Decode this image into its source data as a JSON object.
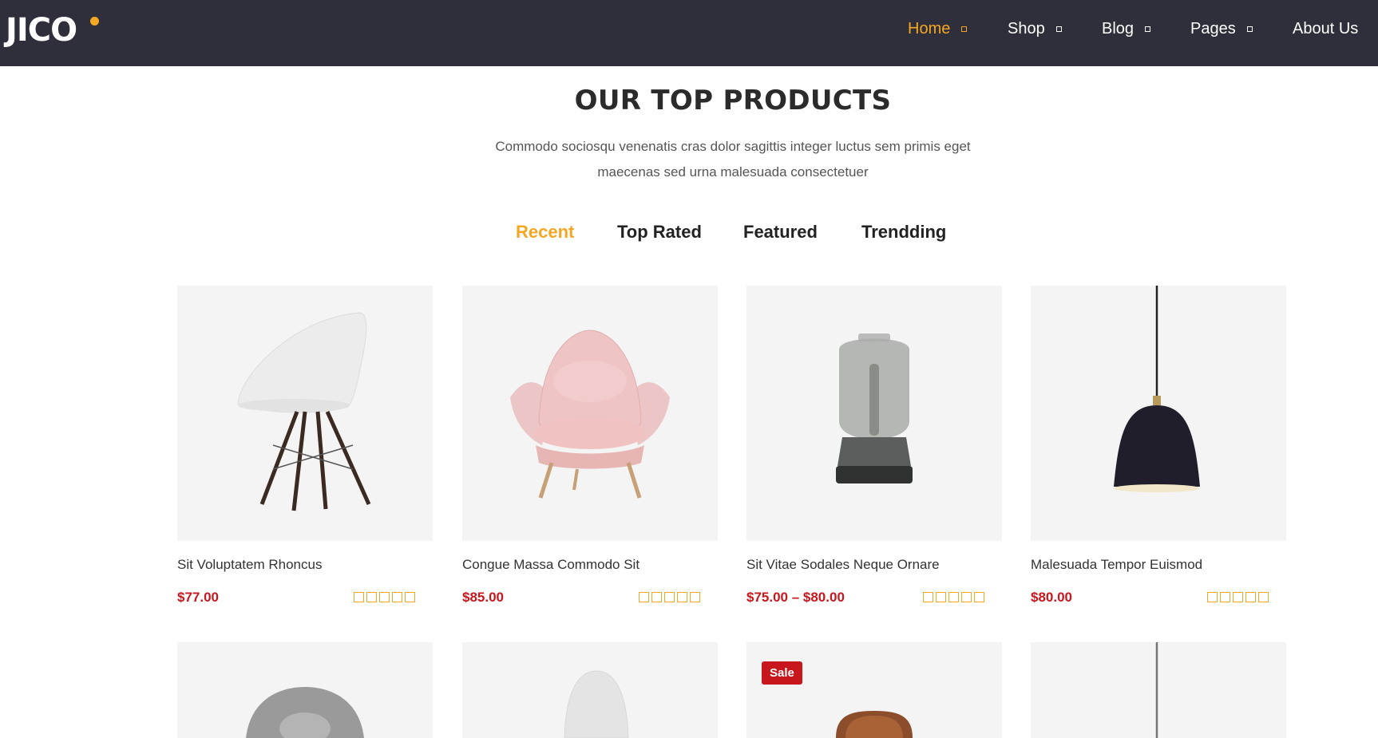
{
  "header": {
    "logo_text": "JICO",
    "nav": [
      {
        "label": "Home",
        "active": true
      },
      {
        "label": "Shop",
        "active": false
      },
      {
        "label": "Blog",
        "active": false
      },
      {
        "label": "Pages",
        "active": false
      },
      {
        "label": "About Us",
        "active": false
      }
    ]
  },
  "section": {
    "title": "OUR TOP PRODUCTS",
    "description_line1": "Commodo sociosqu venenatis cras dolor sagittis integer luctus sem primis eget",
    "description_line2": "maecenas sed urna malesuada consectetuer"
  },
  "tabs": [
    {
      "label": "Recent",
      "active": true
    },
    {
      "label": "Top Rated",
      "active": false
    },
    {
      "label": "Featured",
      "active": false
    },
    {
      "label": "Trendding",
      "active": false
    }
  ],
  "products": [
    {
      "name": "Sit Voluptatem Rhoncus",
      "price": "$77.00",
      "image": "white-shell-chair-icon",
      "rating": 0
    },
    {
      "name": "Congue Massa Commodo Sit",
      "price": "$85.00",
      "image": "pink-armchair-icon",
      "rating": 0
    },
    {
      "name": "Sit Vitae Sodales Neque Ornare",
      "price": "$75.00 – $80.00",
      "image": "glass-table-lamp-icon",
      "rating": 0
    },
    {
      "name": "Malesuada Tempor Euismod",
      "price": "$80.00",
      "image": "black-pendant-lamp-icon",
      "rating": 0
    }
  ],
  "products_row2": [
    {
      "image": "grey-chair-icon"
    },
    {
      "image": "white-chair-icon"
    },
    {
      "image": "wooden-lamp-icon",
      "badge": "Sale"
    },
    {
      "image": "pendant-lamp-icon"
    }
  ],
  "colors": {
    "header_bg": "#2e2f3a",
    "accent": "#f5a623",
    "price": "#c8161d",
    "card_bg": "#f4f4f4"
  }
}
